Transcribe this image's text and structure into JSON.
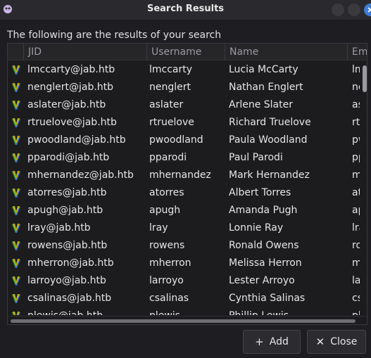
{
  "window": {
    "title": "Search Results"
  },
  "subtitle": "The following are the results of your search",
  "columns": [
    "JID",
    "Username",
    "Name",
    "Em"
  ],
  "rows": [
    {
      "jid": "lmccarty@jab.htb",
      "username": "lmccarty",
      "name": "Lucia McCarty",
      "email": "lm"
    },
    {
      "jid": "nenglert@jab.htb",
      "username": "nenglert",
      "name": "Nathan Englert",
      "email": "ne"
    },
    {
      "jid": "aslater@jab.htb",
      "username": "aslater",
      "name": "Arlene Slater",
      "email": "as"
    },
    {
      "jid": "rtruelove@jab.htb",
      "username": "rtruelove",
      "name": "Richard Truelove",
      "email": "rtr"
    },
    {
      "jid": "pwoodland@jab.htb",
      "username": "pwoodland",
      "name": "Paula Woodland",
      "email": "pw"
    },
    {
      "jid": "pparodi@jab.htb",
      "username": "pparodi",
      "name": "Paul Parodi",
      "email": "pp"
    },
    {
      "jid": "mhernandez@jab.htb",
      "username": "mhernandez",
      "name": "Mark Hernandez",
      "email": "mh"
    },
    {
      "jid": "atorres@jab.htb",
      "username": "atorres",
      "name": "Albert Torres",
      "email": "at"
    },
    {
      "jid": "apugh@jab.htb",
      "username": "apugh",
      "name": "Amanda Pugh",
      "email": "ap"
    },
    {
      "jid": "lray@jab.htb",
      "username": "lray",
      "name": "Lonnie Ray",
      "email": "lra"
    },
    {
      "jid": "rowens@jab.htb",
      "username": "rowens",
      "name": "Ronald Owens",
      "email": "ro"
    },
    {
      "jid": "mherron@jab.htb",
      "username": "mherron",
      "name": "Melissa Herron",
      "email": "mh"
    },
    {
      "jid": "larroyo@jab.htb",
      "username": "larroyo",
      "name": "Lester Arroyo",
      "email": "la"
    },
    {
      "jid": "csalinas@jab.htb",
      "username": "csalinas",
      "name": "Cynthia Salinas",
      "email": "cs"
    },
    {
      "jid": "plewis@jab.htb",
      "username": "plewis",
      "name": "Phillip Lewis",
      "email": "pl"
    }
  ],
  "buttons": {
    "add": "Add",
    "close": "Close"
  },
  "icons": {
    "add": "plus-icon",
    "close": "x-icon",
    "row": "spark-icon"
  },
  "colors": {
    "accent": "#3d7bd6",
    "icon_yellow": "#d8c200",
    "icon_green": "#3ca03c",
    "icon_blue": "#3a6fd8"
  }
}
